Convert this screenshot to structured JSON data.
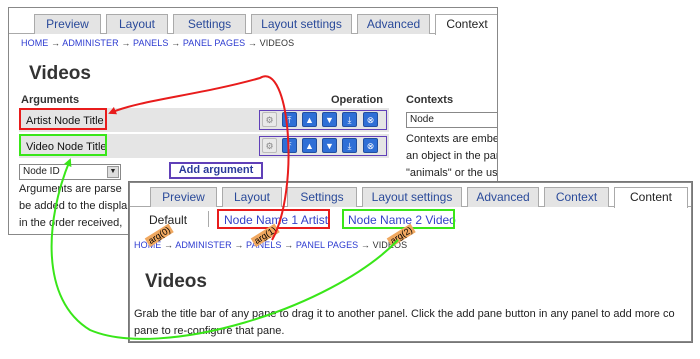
{
  "window1": {
    "tabs": [
      "Preview",
      "Layout",
      "Settings",
      "Layout settings",
      "Advanced",
      "Context"
    ],
    "active_tab": "Context",
    "breadcrumb": [
      "HOME",
      "ADMINISTER",
      "PANELS",
      "PANEL PAGES",
      "VIDEOS"
    ],
    "title": "Videos",
    "arguments_header": "Arguments",
    "operation_header": "Operation",
    "contexts_header": "Contexts",
    "arguments": [
      "Artist Node Title",
      "Video Node Title"
    ],
    "select_value": "Node ID",
    "add_argument_label": "Add argument",
    "context_select_value": "Node",
    "contexts_text": [
      "Contexts are embed",
      "an object in the pane",
      "\"animals\" or the use"
    ],
    "arguments_text": [
      "Arguments are parse",
      "be added to the displa",
      "in the order received,"
    ]
  },
  "window2": {
    "tabs": [
      "Preview",
      "Layout",
      "Settings",
      "Layout settings",
      "Advanced",
      "Context",
      "Content"
    ],
    "active_tab": "Content",
    "subtabs": [
      "Default",
      "Node Name 1 Artist",
      "Node Name 2 Video"
    ],
    "breadcrumb": [
      "HOME",
      "ADMINISTER",
      "PANELS",
      "PANEL PAGES",
      "VIDEOS"
    ],
    "arg_tags": [
      "arg(0)",
      "arg(1)",
      "arg(2)"
    ],
    "title": "Videos",
    "body_text": [
      "Grab the title bar of any pane to drag it to another panel. Click the add pane button in any panel to add more co",
      "pane to re-configure that pane."
    ]
  },
  "colors": {
    "highlight_red": "#e81c1c",
    "highlight_green": "#39e619",
    "link": "#2c3ad0",
    "button_blue": "#2f6fd6"
  },
  "icons": [
    "gear-icon",
    "arrow-up-top-icon",
    "arrow-up-icon",
    "arrow-down-icon",
    "arrow-down-bottom-icon",
    "remove-icon"
  ]
}
